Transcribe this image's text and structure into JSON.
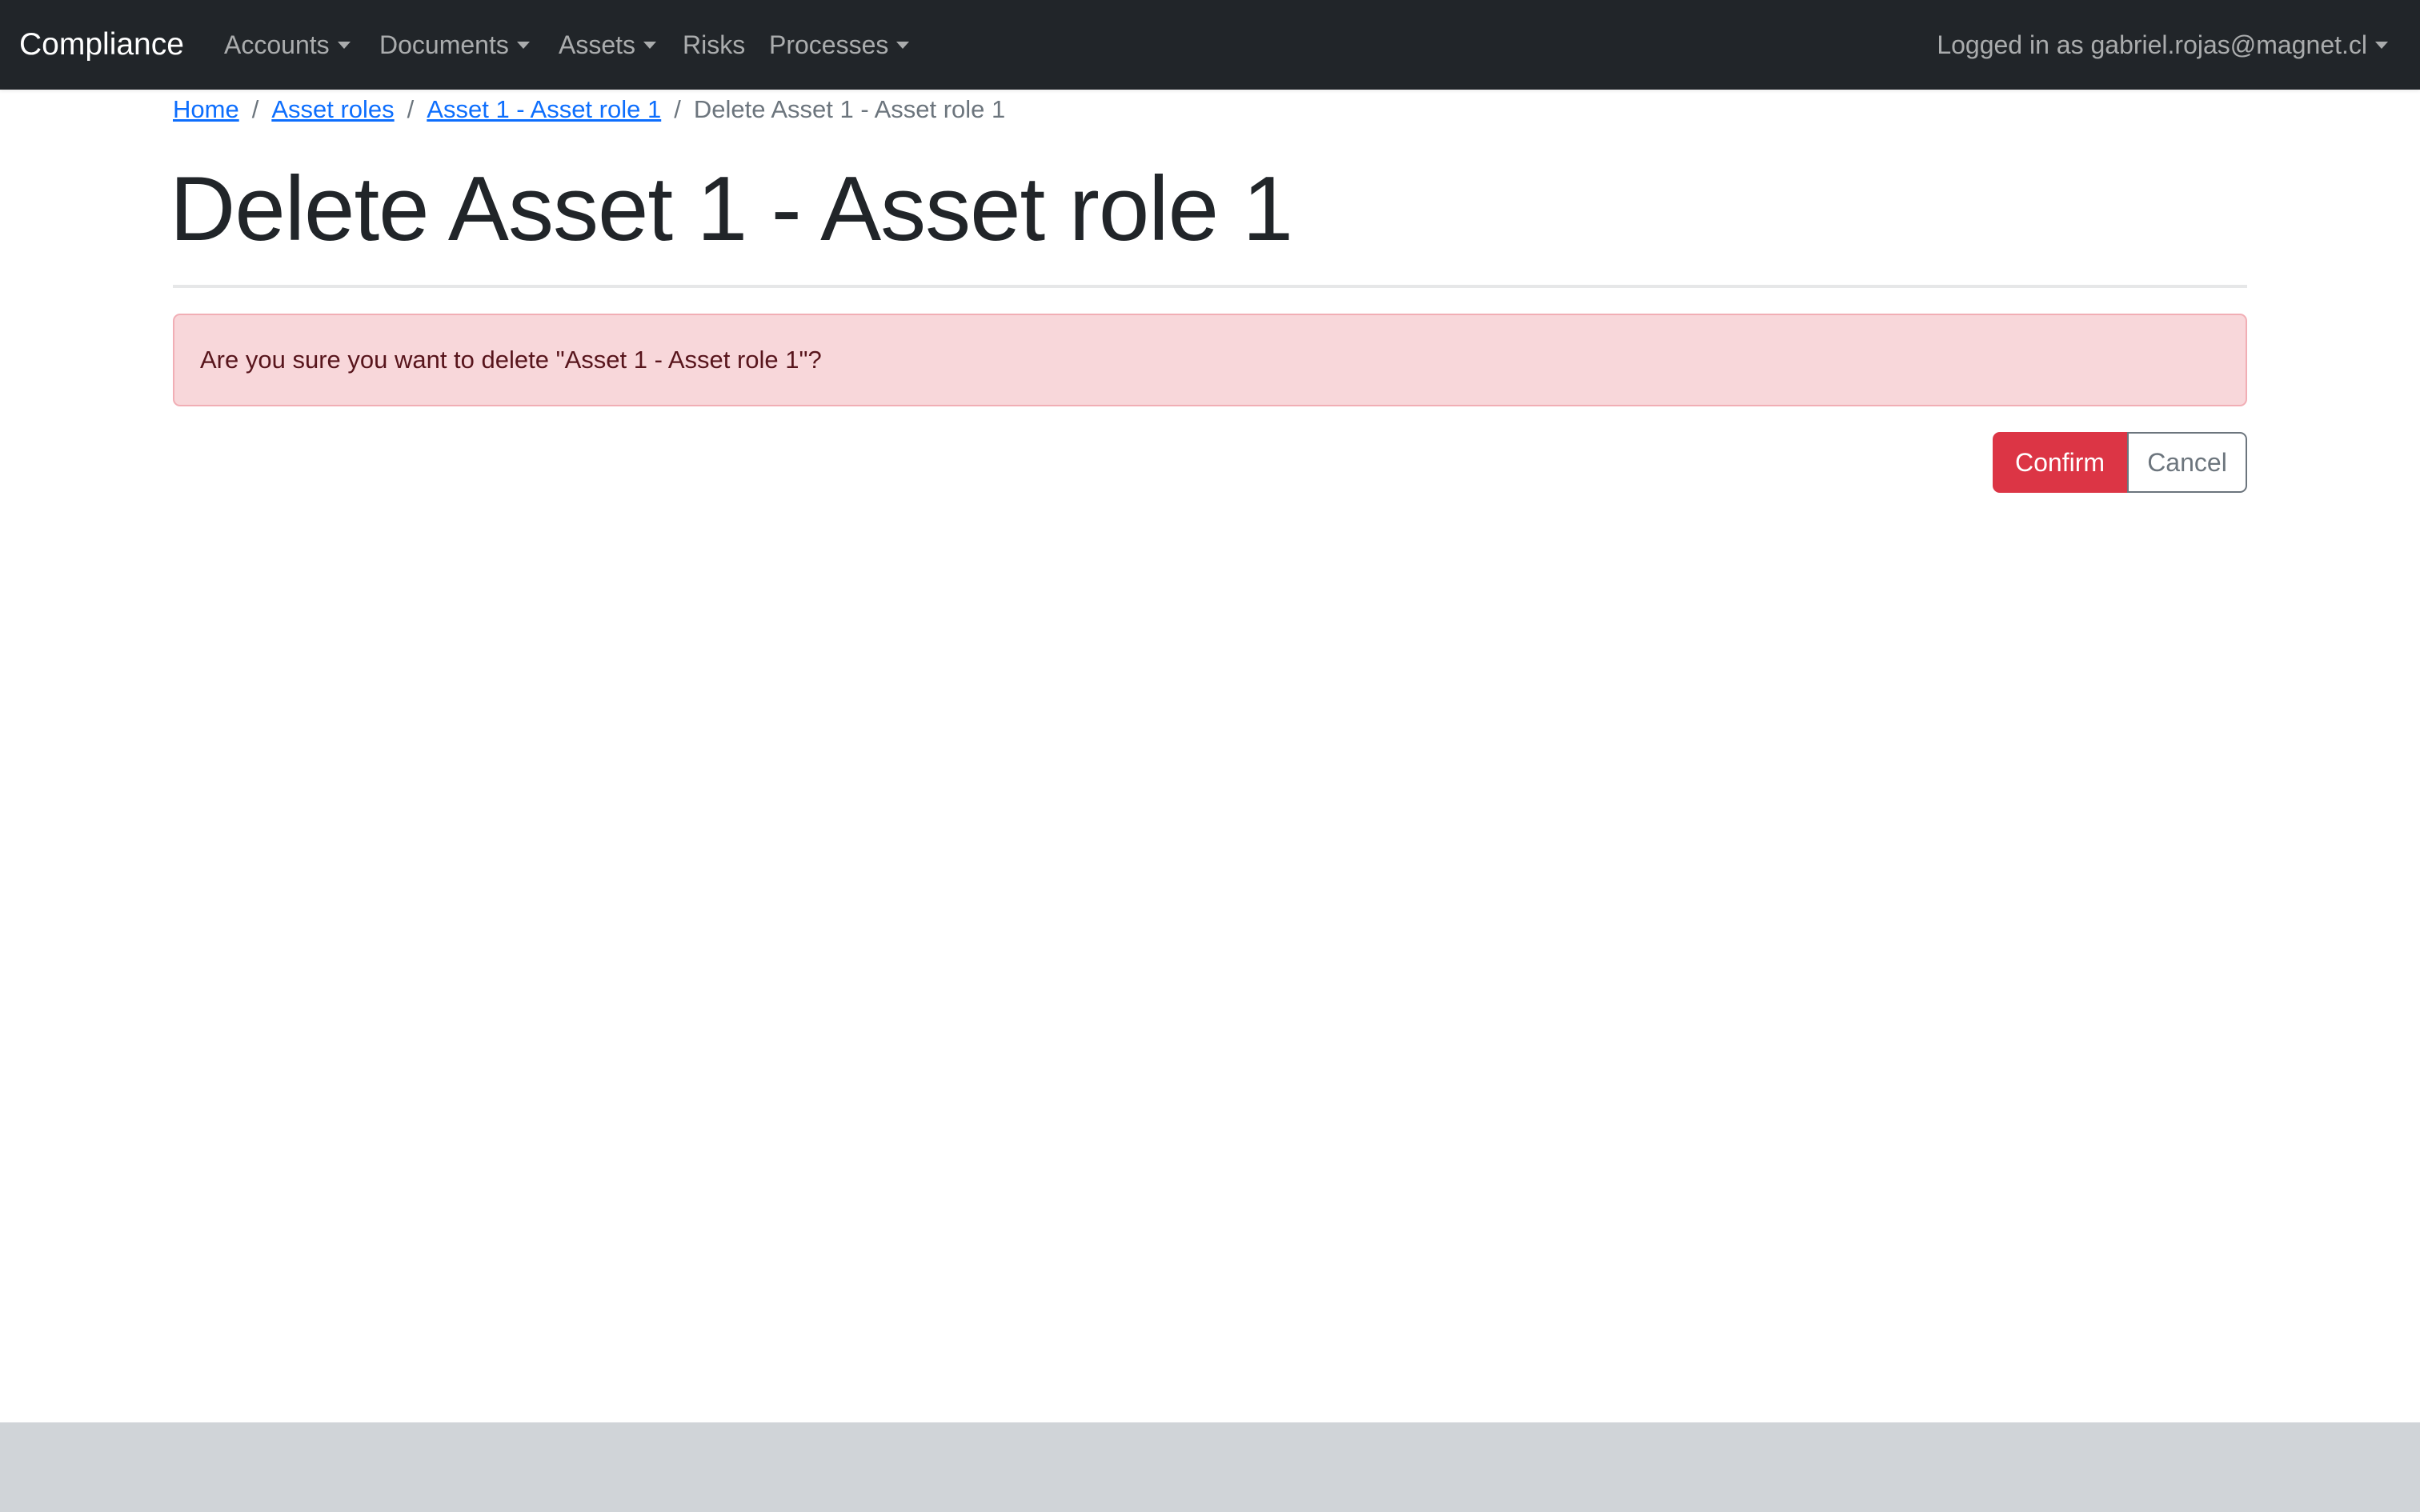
{
  "navbar": {
    "brand": "Compliance",
    "items": [
      {
        "label": "Accounts",
        "dropdown": true
      },
      {
        "label": "Documents",
        "dropdown": true
      },
      {
        "label": "Assets",
        "dropdown": true
      },
      {
        "label": "Risks",
        "dropdown": false
      },
      {
        "label": "Processes",
        "dropdown": true
      }
    ],
    "user_menu": "Logged in as gabriel.rojas@magnet.cl"
  },
  "breadcrumb": {
    "items": [
      "Home",
      "Asset roles",
      "Asset 1 - Asset role 1"
    ],
    "active": "Delete Asset 1 - Asset role 1",
    "separator": "/"
  },
  "page": {
    "title": "Delete Asset 1 - Asset role 1"
  },
  "alert": {
    "message": "Are you sure you want to delete \"Asset 1 - Asset role 1\"?"
  },
  "actions": {
    "confirm_label": "Confirm",
    "cancel_label": "Cancel"
  },
  "colors": {
    "navbar_bg": "#212529",
    "link": "#0d6efd",
    "danger": "#dc3545",
    "alert_bg": "#f8d7da",
    "footer_bg": "#d0d4d8"
  }
}
